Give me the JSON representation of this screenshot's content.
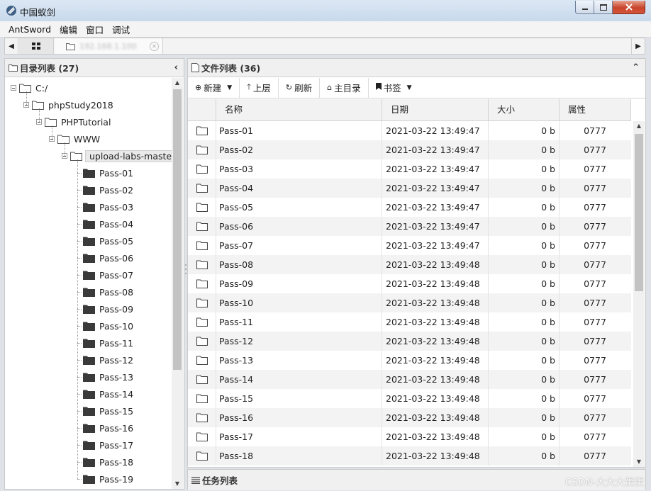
{
  "window": {
    "title": "中国蚁剑"
  },
  "menu": [
    "AntSword",
    "编辑",
    "窗口",
    "调试"
  ],
  "tabs": {
    "shell_tab_label": "192.168.1.100",
    "shell_tab_blurred": true
  },
  "dir_panel": {
    "title": "目录列表 (27)",
    "tree": [
      {
        "label": "C:/",
        "level": 0,
        "expanded": true,
        "icon": "folder-open-icon"
      },
      {
        "label": "phpStudy2018",
        "level": 1,
        "expanded": true,
        "icon": "folder-open-icon"
      },
      {
        "label": "PHPTutorial",
        "level": 2,
        "expanded": true,
        "icon": "folder-open-icon"
      },
      {
        "label": "WWW",
        "level": 3,
        "expanded": true,
        "icon": "folder-open-icon"
      },
      {
        "label": "upload-labs-master",
        "level": 4,
        "expanded": true,
        "selected": true,
        "icon": "folder-open-icon"
      },
      {
        "label": "Pass-01",
        "level": 5,
        "icon": "folder-icon"
      },
      {
        "label": "Pass-02",
        "level": 5,
        "icon": "folder-icon"
      },
      {
        "label": "Pass-03",
        "level": 5,
        "icon": "folder-icon"
      },
      {
        "label": "Pass-04",
        "level": 5,
        "icon": "folder-icon"
      },
      {
        "label": "Pass-05",
        "level": 5,
        "icon": "folder-icon"
      },
      {
        "label": "Pass-06",
        "level": 5,
        "icon": "folder-icon"
      },
      {
        "label": "Pass-07",
        "level": 5,
        "icon": "folder-icon"
      },
      {
        "label": "Pass-08",
        "level": 5,
        "icon": "folder-icon"
      },
      {
        "label": "Pass-09",
        "level": 5,
        "icon": "folder-icon"
      },
      {
        "label": "Pass-10",
        "level": 5,
        "icon": "folder-icon"
      },
      {
        "label": "Pass-11",
        "level": 5,
        "icon": "folder-icon"
      },
      {
        "label": "Pass-12",
        "level": 5,
        "icon": "folder-icon"
      },
      {
        "label": "Pass-13",
        "level": 5,
        "icon": "folder-icon"
      },
      {
        "label": "Pass-14",
        "level": 5,
        "icon": "folder-icon"
      },
      {
        "label": "Pass-15",
        "level": 5,
        "icon": "folder-icon"
      },
      {
        "label": "Pass-16",
        "level": 5,
        "icon": "folder-icon"
      },
      {
        "label": "Pass-17",
        "level": 5,
        "icon": "folder-icon"
      },
      {
        "label": "Pass-18",
        "level": 5,
        "icon": "folder-icon"
      },
      {
        "label": "Pass-19",
        "level": 5,
        "icon": "folder-icon"
      }
    ]
  },
  "file_panel": {
    "title": "文件列表 (36)",
    "toolbar": {
      "new_label": "新建",
      "up_label": "上层",
      "refresh_label": "刷新",
      "home_label": "主目录",
      "bookmark_label": "书签"
    },
    "columns": {
      "name": "名称",
      "date": "日期",
      "size": "大小",
      "attr": "属性"
    },
    "rows": [
      {
        "name": "Pass-01",
        "date": "2021-03-22 13:49:47",
        "size": "0 b",
        "attr": "0777"
      },
      {
        "name": "Pass-02",
        "date": "2021-03-22 13:49:47",
        "size": "0 b",
        "attr": "0777"
      },
      {
        "name": "Pass-03",
        "date": "2021-03-22 13:49:47",
        "size": "0 b",
        "attr": "0777"
      },
      {
        "name": "Pass-04",
        "date": "2021-03-22 13:49:47",
        "size": "0 b",
        "attr": "0777"
      },
      {
        "name": "Pass-05",
        "date": "2021-03-22 13:49:47",
        "size": "0 b",
        "attr": "0777"
      },
      {
        "name": "Pass-06",
        "date": "2021-03-22 13:49:47",
        "size": "0 b",
        "attr": "0777"
      },
      {
        "name": "Pass-07",
        "date": "2021-03-22 13:49:47",
        "size": "0 b",
        "attr": "0777"
      },
      {
        "name": "Pass-08",
        "date": "2021-03-22 13:49:48",
        "size": "0 b",
        "attr": "0777"
      },
      {
        "name": "Pass-09",
        "date": "2021-03-22 13:49:48",
        "size": "0 b",
        "attr": "0777"
      },
      {
        "name": "Pass-10",
        "date": "2021-03-22 13:49:48",
        "size": "0 b",
        "attr": "0777"
      },
      {
        "name": "Pass-11",
        "date": "2021-03-22 13:49:48",
        "size": "0 b",
        "attr": "0777"
      },
      {
        "name": "Pass-12",
        "date": "2021-03-22 13:49:48",
        "size": "0 b",
        "attr": "0777"
      },
      {
        "name": "Pass-13",
        "date": "2021-03-22 13:49:48",
        "size": "0 b",
        "attr": "0777"
      },
      {
        "name": "Pass-14",
        "date": "2021-03-22 13:49:48",
        "size": "0 b",
        "attr": "0777"
      },
      {
        "name": "Pass-15",
        "date": "2021-03-22 13:49:48",
        "size": "0 b",
        "attr": "0777"
      },
      {
        "name": "Pass-16",
        "date": "2021-03-22 13:49:48",
        "size": "0 b",
        "attr": "0777"
      },
      {
        "name": "Pass-17",
        "date": "2021-03-22 13:49:48",
        "size": "0 b",
        "attr": "0777"
      },
      {
        "name": "Pass-18",
        "date": "2021-03-22 13:49:48",
        "size": "0 b",
        "attr": "0777"
      }
    ]
  },
  "task_panel": {
    "title": "任务列表"
  },
  "watermark": "CSDN-大大大蛋蛋"
}
